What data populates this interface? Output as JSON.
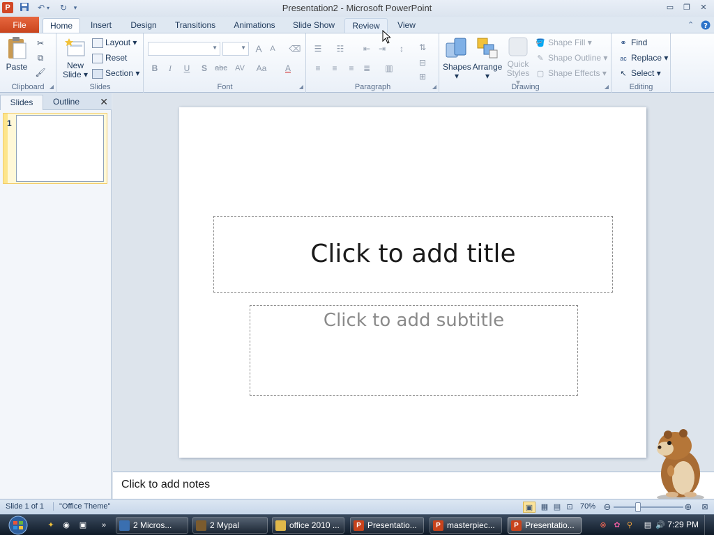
{
  "window": {
    "title": "Presentation2 - Microsoft PowerPoint",
    "app_icon_letter": "P",
    "minimize": "▭",
    "restore": "❐",
    "close": "✕"
  },
  "tabs": {
    "file": "File",
    "items": [
      "Home",
      "Insert",
      "Design",
      "Transitions",
      "Animations",
      "Slide Show",
      "Review",
      "View"
    ],
    "active": "Home"
  },
  "ribbon": {
    "clipboard": {
      "label": "Clipboard",
      "paste": "Paste"
    },
    "slides": {
      "label": "Slides",
      "new_slide_line1": "New",
      "new_slide_line2": "Slide",
      "layout": "Layout",
      "reset": "Reset",
      "section": "Section"
    },
    "font": {
      "label": "Font",
      "bold": "B",
      "italic": "I",
      "underline": "U",
      "shadow": "S",
      "strike": "abc",
      "spacing": "AV",
      "case": "Aa",
      "color": "A",
      "grow": "A",
      "shrink": "A"
    },
    "paragraph": {
      "label": "Paragraph"
    },
    "drawing": {
      "label": "Drawing",
      "shapes": "Shapes",
      "arrange": "Arrange",
      "quick_styles_line1": "Quick",
      "quick_styles_line2": "Styles",
      "shape_fill": "Shape Fill",
      "shape_outline": "Shape Outline",
      "shape_effects": "Shape Effects"
    },
    "editing": {
      "label": "Editing",
      "find": "Find",
      "replace": "Replace",
      "select": "Select"
    }
  },
  "left_panel": {
    "tab_slides": "Slides",
    "tab_outline": "Outline",
    "close": "✕",
    "slide_number": "1"
  },
  "slide": {
    "title_placeholder": "Click to add title",
    "subtitle_placeholder": "Click to add subtitle"
  },
  "notes": {
    "placeholder": "Click to add notes"
  },
  "status": {
    "slide_of": "Slide 1 of 1",
    "theme": "\"Office Theme\"",
    "zoom": "70%",
    "zoom_level_fraction": 0.35
  },
  "taskbar": {
    "buttons": [
      {
        "label": "2 Micros...",
        "icon_color": "#3a6fb0"
      },
      {
        "label": "2 Mypal",
        "icon_color": "#7b5b2e"
      },
      {
        "label": "office 2010 ...",
        "icon_color": "#e0b84a"
      },
      {
        "label": "Presentatio...",
        "icon_color": "#c8431c"
      },
      {
        "label": "masterpiec...",
        "icon_color": "#c8431c"
      },
      {
        "label": "Presentatio...",
        "icon_color": "#c8431c"
      }
    ],
    "clock": "7:29 PM"
  },
  "colors": {
    "file_tab": "#c8431c",
    "ribbon_bg": "#fdfeff",
    "accent": "#1e395b",
    "selection": "#fde58b"
  }
}
